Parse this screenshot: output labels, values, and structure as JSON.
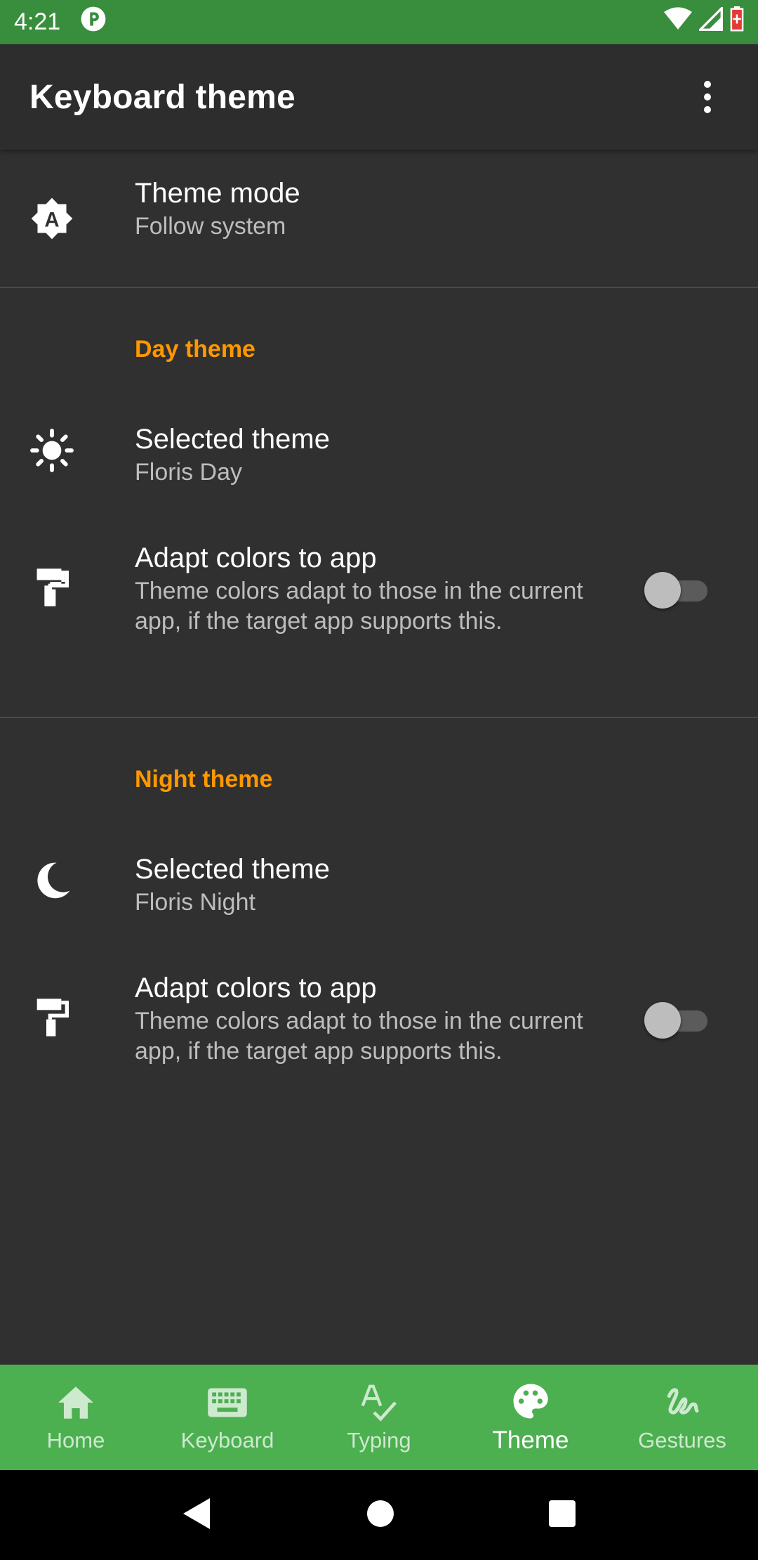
{
  "status_bar": {
    "time": "4:21"
  },
  "app_bar": {
    "title": "Keyboard theme"
  },
  "theme_mode": {
    "title": "Theme mode",
    "summary": "Follow system"
  },
  "day": {
    "category": "Day theme",
    "selected": {
      "title": "Selected theme",
      "summary": "Floris Day"
    },
    "adapt": {
      "title": "Adapt colors to app",
      "summary": "Theme colors adapt to those in the current app, if the target app supports this.",
      "enabled": false
    }
  },
  "night": {
    "category": "Night theme",
    "selected": {
      "title": "Selected theme",
      "summary": "Floris Night"
    },
    "adapt": {
      "title": "Adapt colors to app",
      "summary": "Theme colors adapt to those in the current app, if the target app supports this.",
      "enabled": false
    }
  },
  "bottom_nav": [
    {
      "label": "Home",
      "icon": "home-icon",
      "active": false
    },
    {
      "label": "Keyboard",
      "icon": "keyboard-icon",
      "active": false
    },
    {
      "label": "Typing",
      "icon": "spellcheck-icon",
      "active": false
    },
    {
      "label": "Theme",
      "icon": "palette-icon",
      "active": true
    },
    {
      "label": "Gestures",
      "icon": "gesture-icon",
      "active": false
    }
  ],
  "colors": {
    "status_bar": "#388e3c",
    "bottom_nav": "#4caf50",
    "accent": "#ff9800",
    "background": "#303030"
  }
}
